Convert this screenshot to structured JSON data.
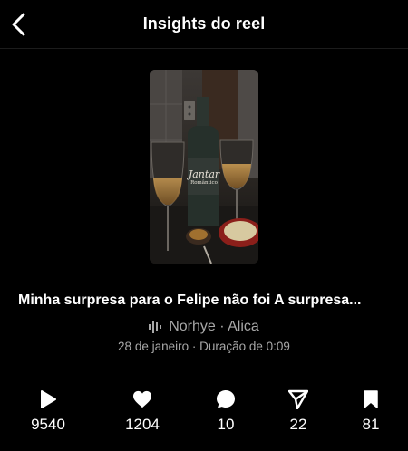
{
  "header": {
    "title": "Insights do reel",
    "back_icon": "chevron-left-icon"
  },
  "reel": {
    "thumbnail_text": {
      "line1": "Jantar",
      "line2": "Romântico"
    },
    "caption": "Minha surpresa para o Felipe não foi  A surpresa...",
    "audio": {
      "icon": "audio-waveform-icon",
      "text": "Norhye · Alica"
    },
    "meta": "28 de janeiro · Duração de 0:09"
  },
  "stats": [
    {
      "icon": "play-icon",
      "value": "9540"
    },
    {
      "icon": "heart-icon",
      "value": "1204"
    },
    {
      "icon": "comment-icon",
      "value": "10"
    },
    {
      "icon": "share-icon",
      "value": "22"
    },
    {
      "icon": "bookmark-icon",
      "value": "81"
    }
  ],
  "colors": {
    "background": "#000000",
    "text": "#ffffff",
    "secondary_text": "#a8a8a8"
  }
}
